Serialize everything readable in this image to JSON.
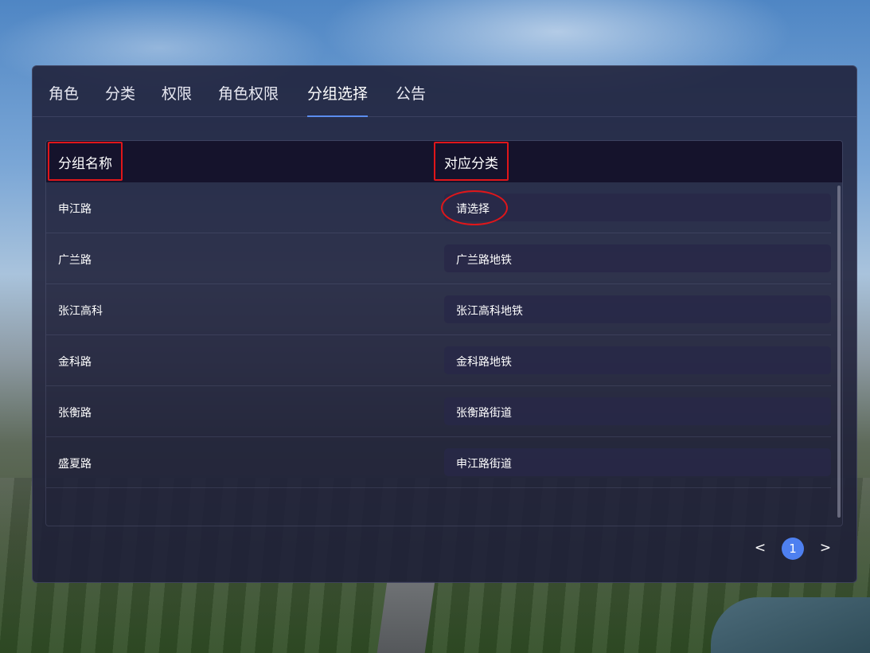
{
  "tabs": [
    {
      "label": "角色",
      "active": false
    },
    {
      "label": "分类",
      "active": false
    },
    {
      "label": "权限",
      "active": false
    },
    {
      "label": "角色权限",
      "active": false
    },
    {
      "label": "分组选择",
      "active": true
    },
    {
      "label": "公告",
      "active": false
    }
  ],
  "table": {
    "headers": {
      "name": "分组名称",
      "category": "对应分类"
    },
    "rows": [
      {
        "name": "申江路",
        "category": "请选择"
      },
      {
        "name": "广兰路",
        "category": "广兰路地铁"
      },
      {
        "name": "张江高科",
        "category": "张江高科地铁"
      },
      {
        "name": "金科路",
        "category": "金科路地铁"
      },
      {
        "name": "张衡路",
        "category": "张衡路街道"
      },
      {
        "name": "盛夏路",
        "category": "申江路街道"
      }
    ]
  },
  "pagination": {
    "prev": "<",
    "current": "1",
    "next": ">"
  },
  "colors": {
    "accent": "#5b8def",
    "highlight": "#e0161a",
    "panel": "#1e1f38"
  }
}
